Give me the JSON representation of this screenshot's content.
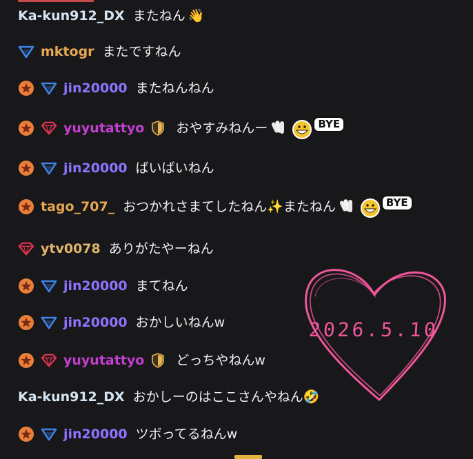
{
  "messages": [
    {
      "badges": [],
      "user": "Ka-kun912_DX",
      "user_color": "white",
      "text": "またねん",
      "emote": "wave-hand"
    },
    {
      "badges": [
        "prime-icon"
      ],
      "user": "mktogr",
      "user_color": "gold",
      "text": "またですねん"
    },
    {
      "badges": [
        "star-badge",
        "prime-icon"
      ],
      "user": "jin20000",
      "user_color": "blue",
      "text": "またねんねん"
    },
    {
      "badges": [
        "star-badge",
        "gem-badge"
      ],
      "user": "yuyutattyo",
      "user_color": "purple",
      "mod": true,
      "text": "おやすみねんー",
      "emote": "bye",
      "emote_text": "BYE"
    },
    {
      "badges": [
        "star-badge",
        "prime-icon"
      ],
      "user": "jin20000",
      "user_color": "blue",
      "text": "ばいばいねん"
    },
    {
      "badges": [
        "star-badge"
      ],
      "user": "tago_707_",
      "user_color": "gold",
      "text": "おつかれさまてしたねん✨またねん",
      "emote": "bye",
      "emote_text": "BYE"
    },
    {
      "badges": [
        "gem-badge"
      ],
      "user": "ytv0078",
      "user_color": "ytv",
      "text": "ありがたやーねん"
    },
    {
      "badges": [
        "star-badge",
        "prime-icon"
      ],
      "user": "jin20000",
      "user_color": "blue",
      "text": "まてねん"
    },
    {
      "badges": [
        "star-badge",
        "prime-icon"
      ],
      "user": "jin20000",
      "user_color": "blue",
      "text": "おかしいねんw"
    },
    {
      "badges": [
        "star-badge",
        "gem-badge"
      ],
      "user": "yuyutattyo",
      "user_color": "purple",
      "mod": true,
      "text": "どっちやねんw"
    },
    {
      "badges": [],
      "user": "Ka-kun912_DX",
      "user_color": "white",
      "text": "おかしーのはここさんやねん🤣"
    },
    {
      "badges": [
        "star-badge",
        "prime-icon"
      ],
      "user": "jin20000",
      "user_color": "blue",
      "text": "ツボってるねんw"
    }
  ],
  "overlay": {
    "date": "2026.5.10",
    "shape": "heart",
    "color": "#f0569a"
  },
  "colors": {
    "background": "#18181b",
    "text": "#efeff1",
    "star": "#e97f3a",
    "prime": "#3d84e8",
    "gem": "#e0334f"
  }
}
